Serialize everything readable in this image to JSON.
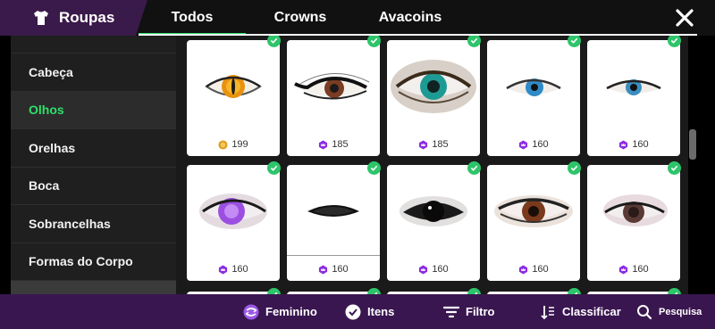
{
  "header": {
    "title": "Roupas",
    "tabs": [
      {
        "label": "Todos"
      },
      {
        "label": "Crowns"
      },
      {
        "label": "Avacoins"
      }
    ]
  },
  "sidebar": {
    "items": [
      {
        "label": "Cabeça"
      },
      {
        "label": "Olhos"
      },
      {
        "label": "Orelhas"
      },
      {
        "label": "Boca"
      },
      {
        "label": "Sobrancelhas"
      },
      {
        "label": "Formas do Corpo"
      }
    ],
    "active": "Olhos"
  },
  "grid": {
    "items": [
      {
        "price": "199",
        "currency": "avacoin-icon",
        "owned": true
      },
      {
        "price": "185",
        "currency": "crown-icon",
        "owned": true
      },
      {
        "price": "185",
        "currency": "crown-icon",
        "owned": true
      },
      {
        "price": "160",
        "currency": "crown-icon",
        "owned": true
      },
      {
        "price": "160",
        "currency": "crown-icon",
        "owned": true
      },
      {
        "price": "160",
        "currency": "crown-icon",
        "owned": true
      },
      {
        "price": "160",
        "currency": "crown-icon",
        "owned": true
      },
      {
        "price": "160",
        "currency": "crown-icon",
        "owned": true
      },
      {
        "price": "160",
        "currency": "crown-icon",
        "owned": true
      },
      {
        "price": "160",
        "currency": "crown-icon",
        "owned": true
      }
    ]
  },
  "bottombar": {
    "gender": "Feminino",
    "items": "Itens",
    "filter": "Filtro",
    "sort": "Classificar",
    "search": "Pesquisa"
  },
  "colors": {
    "accent": "#2ee06a",
    "brand": "#3a1650",
    "crown": "#8a2be2",
    "avacoin": "#e0a020"
  }
}
